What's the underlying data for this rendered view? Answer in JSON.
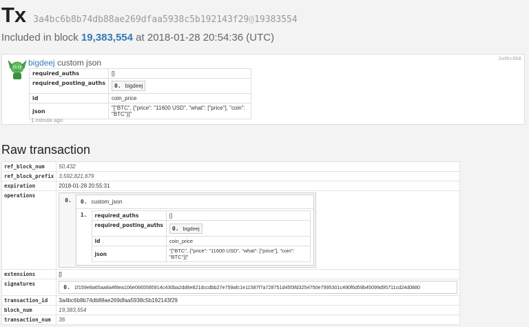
{
  "header": {
    "tx_label": "Tx",
    "tx_hash": "3a4bc6b8b74db88ae269dfaa5938c5b192143f29",
    "at_sign": "@",
    "block_ref": "19383554",
    "included_prefix": "Included in block",
    "included_block": "19,383,554",
    "included_at": "at 2018-01-28 20:54:36 (UTC)"
  },
  "op_card": {
    "account": "bigdeej",
    "op_type": "custom json",
    "short_id": "3a4bc6b8",
    "ago": "1 minute ago",
    "rows": {
      "required_auths_key": "required_auths",
      "required_auths_val": "[]",
      "required_posting_auths_key": "required_posting_auths",
      "required_posting_auths_idx": "0.",
      "required_posting_auths_val": "bigdeej",
      "id_key": "id",
      "id_val": "coin_price",
      "json_key": "json",
      "json_val": "\"[\"BTC\", {\"price\": \"11600 USD\", \"what\": [\"price\"], \"coin\": \"BTC\"}]\""
    }
  },
  "raw": {
    "heading": "Raw transaction",
    "ref_block_num_key": "ref_block_num",
    "ref_block_num": "50,432",
    "ref_block_prefix_key": "ref_block_prefix",
    "ref_block_prefix": "3,592,821,679",
    "expiration_key": "expiration",
    "expiration": "2018-01-28 20:55:31",
    "operations_key": "operations",
    "op_idx": "0.",
    "op_name_idx": "0.",
    "op_name": "custom_json",
    "op_body_idx": "1.",
    "body": {
      "required_auths_key": "required_auths",
      "required_auths_val": "[]",
      "required_posting_auths_key": "required_posting_auths",
      "required_posting_auths_idx": "0.",
      "required_posting_auths_val": "bigdeej",
      "id_key": "id",
      "id_val": "coin_price",
      "json_key": "json",
      "json_val": "\"[\"BTC\", {\"price\": \"11600 USD\", \"what\": [\"price\"], \"coin\": \"BTC\"}]\""
    },
    "extensions_key": "extensions",
    "extensions": "[]",
    "signatures_key": "signatures",
    "sig_idx": "0.",
    "signature": "1f159e8a65aa8a4f8ea106e0665585914c430ba2dd6e821dccdbb27e759afc1e11587f7a728751d45f3fd3254750e7995301c490f6d59b45099d95711cd24d0880",
    "transaction_id_key": "transaction_id",
    "transaction_id": "3a4bc6b8b74db88ae269dfaa5938c5b192143f29",
    "block_num_key": "block_num",
    "block_num": "19,383,554",
    "transaction_num_key": "transaction_num",
    "transaction_num": "36"
  },
  "colors": {
    "link": "#337ab7",
    "background": "#f3f3f3",
    "avatar_green": "#4aa74a"
  },
  "icons": {
    "avatar": "green-alien-avatar"
  }
}
